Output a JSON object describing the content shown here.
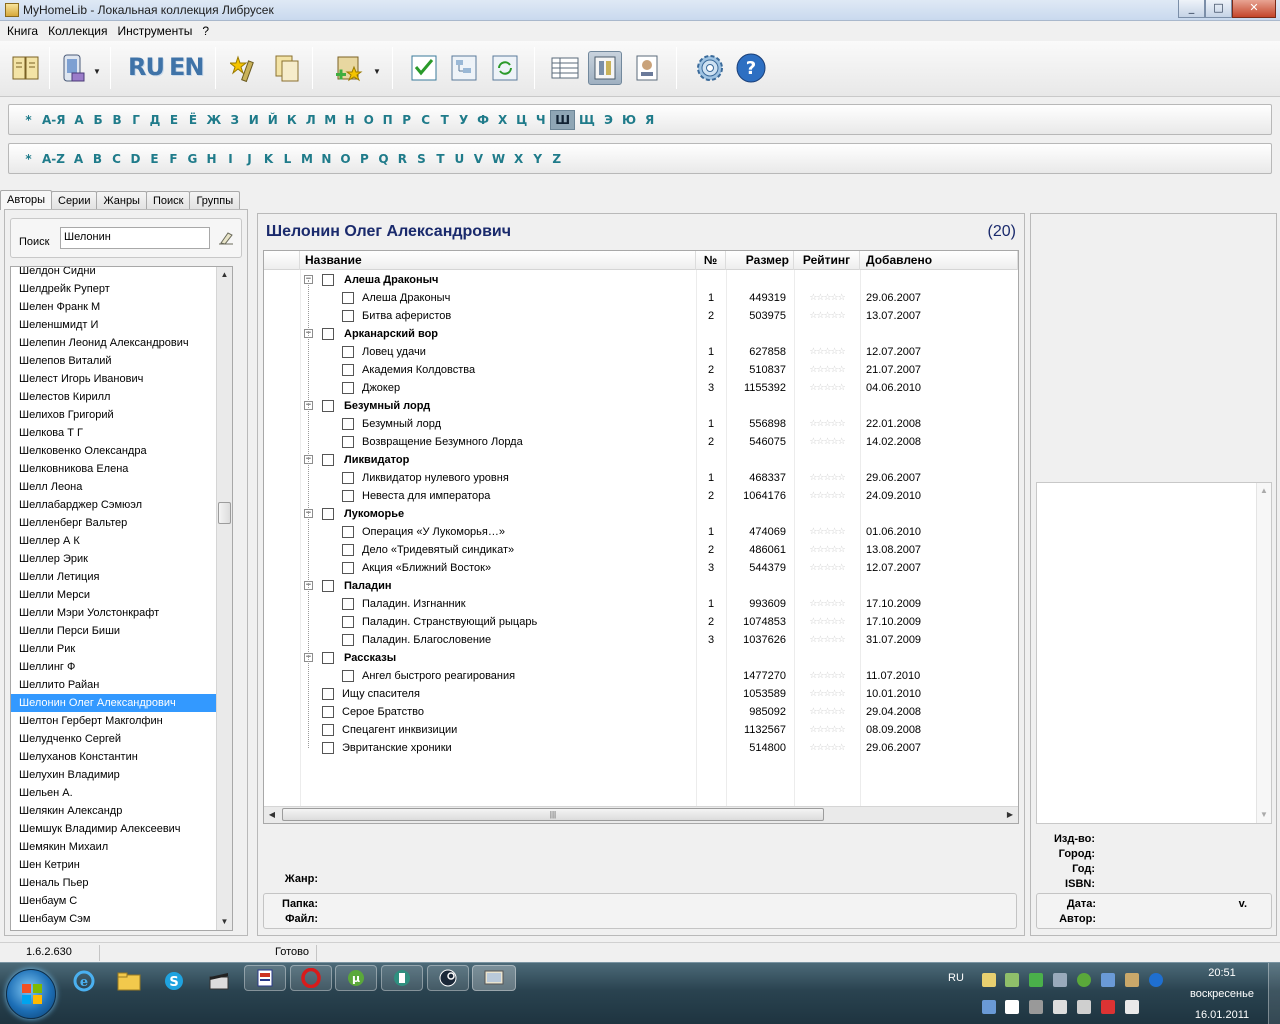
{
  "window": {
    "title": "MyHomeLib - Локальная коллекция Либрусек",
    "btn_min": "_",
    "btn_max": "□",
    "btn_close": "✕"
  },
  "menu": [
    "Книга",
    "Коллекция",
    "Инструменты",
    "?"
  ],
  "toolbar": {
    "lang_ru": "RU",
    "lang_en": "EN"
  },
  "alphabet_ru": [
    "*",
    "А-Я",
    "А",
    "Б",
    "В",
    "Г",
    "Д",
    "Е",
    "Ё",
    "Ж",
    "З",
    "И",
    "Й",
    "К",
    "Л",
    "М",
    "Н",
    "О",
    "П",
    "Р",
    "С",
    "Т",
    "У",
    "Ф",
    "Х",
    "Ц",
    "Ч",
    "Ш",
    "Щ",
    "Э",
    "Ю",
    "Я"
  ],
  "alphabet_ru_selected": "Ш",
  "alphabet_en": [
    "*",
    "A-Z",
    "A",
    "B",
    "C",
    "D",
    "E",
    "F",
    "G",
    "H",
    "I",
    "J",
    "K",
    "L",
    "M",
    "N",
    "O",
    "P",
    "Q",
    "R",
    "S",
    "T",
    "U",
    "V",
    "W",
    "X",
    "Y",
    "Z"
  ],
  "tabs": [
    "Авторы",
    "Серии",
    "Жанры",
    "Поиск",
    "Группы"
  ],
  "search": {
    "label": "Поиск",
    "value": "Шелонин"
  },
  "authors": [
    "Шелдон Сидни",
    "Шелдрейк Руперт",
    "Шелен Франк М",
    "Шеленшмидт И",
    "Шелепин Леонид Александрович",
    "Шелепов Виталий",
    "Шелест Игорь Иванович",
    "Шелестов Кирилл",
    "Шелихов Григорий",
    "Шелкова Т Г",
    "Шелковенко Олександра",
    "Шелковникова Елена",
    "Шелл Леона",
    "Шеллабарджер Сэмюэл",
    "Шелленберг Вальтер",
    "Шеллер А К",
    "Шеллер Эрик",
    "Шелли Летиция",
    "Шелли Мерси",
    "Шелли Мэри Уолстонкрафт",
    "Шелли Перси Биши",
    "Шелли Рик",
    "Шеллинг Ф",
    "Шеллито Райан",
    "Шелонин Олег Александрович",
    "Шелтон Герберт Макголфин",
    "Шелудченко Сергей",
    "Шелуханов Константин",
    "Шелухин Владимир",
    "Шельен А.",
    "Шелякин Александр",
    "Шемшук Владимир Алексеевич",
    "Шемякин Михаил",
    "Шен Кетрин",
    "Шеналь Пьер",
    "Шенбаум С",
    "Шенбаум Сэм"
  ],
  "authors_selected_index": 24,
  "center": {
    "author": "Шелонин Олег Александрович",
    "count": "(20)",
    "headers": {
      "title": "Название",
      "num": "№",
      "size": "Размер",
      "rating": "Рейтинг",
      "added": "Добавлено"
    },
    "rows": [
      {
        "type": "group",
        "title": "Алеша Драконыч"
      },
      {
        "type": "book",
        "title": "Алеша Драконыч",
        "num": "1",
        "size": "449319",
        "rating": "☆☆☆☆☆",
        "added": "29.06.2007"
      },
      {
        "type": "book",
        "title": "Битва аферистов",
        "num": "2",
        "size": "503975",
        "rating": "☆☆☆☆☆",
        "added": "13.07.2007"
      },
      {
        "type": "group",
        "title": "Арканарский вор"
      },
      {
        "type": "book",
        "title": "Ловец удачи",
        "num": "1",
        "size": "627858",
        "rating": "☆☆☆☆☆",
        "added": "12.07.2007"
      },
      {
        "type": "book",
        "title": "Академия Колдовства",
        "num": "2",
        "size": "510837",
        "rating": "☆☆☆☆☆",
        "added": "21.07.2007"
      },
      {
        "type": "book",
        "title": "Джокер",
        "num": "3",
        "size": "1155392",
        "rating": "☆☆☆☆☆",
        "added": "04.06.2010"
      },
      {
        "type": "group",
        "title": "Безумный лорд"
      },
      {
        "type": "book",
        "title": "Безумный лорд",
        "num": "1",
        "size": "556898",
        "rating": "☆☆☆☆☆",
        "added": "22.01.2008"
      },
      {
        "type": "book",
        "title": "Возвращение Безумного Лорда",
        "num": "2",
        "size": "546075",
        "rating": "☆☆☆☆☆",
        "added": "14.02.2008"
      },
      {
        "type": "group",
        "title": "Ликвидатор"
      },
      {
        "type": "book",
        "title": "Ликвидатор нулевого уровня",
        "num": "1",
        "size": "468337",
        "rating": "☆☆☆☆☆",
        "added": "29.06.2007"
      },
      {
        "type": "book",
        "title": "Невеста для императора",
        "num": "2",
        "size": "1064176",
        "rating": "☆☆☆☆☆",
        "added": "24.09.2010"
      },
      {
        "type": "group",
        "title": "Лукоморье"
      },
      {
        "type": "book",
        "title": "Операция «У Лукоморья…»",
        "num": "1",
        "size": "474069",
        "rating": "☆☆☆☆☆",
        "added": "01.06.2010"
      },
      {
        "type": "book",
        "title": "Дело «Тридевятый синдикат»",
        "num": "2",
        "size": "486061",
        "rating": "☆☆☆☆☆",
        "added": "13.08.2007"
      },
      {
        "type": "book",
        "title": "Акция «Ближний Восток»",
        "num": "3",
        "size": "544379",
        "rating": "☆☆☆☆☆",
        "added": "12.07.2007"
      },
      {
        "type": "group",
        "title": "Паладин"
      },
      {
        "type": "book",
        "title": "Паладин. Изгнанник",
        "num": "1",
        "size": "993609",
        "rating": "☆☆☆☆☆",
        "added": "17.10.2009"
      },
      {
        "type": "book",
        "title": "Паладин. Странствующий рыцарь",
        "num": "2",
        "size": "1074853",
        "rating": "☆☆☆☆☆",
        "added": "17.10.2009"
      },
      {
        "type": "book",
        "title": "Паладин. Благословение",
        "num": "3",
        "size": "1037626",
        "rating": "☆☆☆☆☆",
        "added": "31.07.2009"
      },
      {
        "type": "group",
        "title": "Рассказы"
      },
      {
        "type": "book",
        "title": "Ангел быстрого реагирования",
        "num": "",
        "size": "1477270",
        "rating": "☆☆☆☆☆",
        "added": "11.07.2010"
      },
      {
        "type": "single",
        "title": "Ищу спасителя",
        "num": "",
        "size": "1053589",
        "rating": "☆☆☆☆☆",
        "added": "10.01.2010"
      },
      {
        "type": "single",
        "title": "Серое Братство",
        "num": "",
        "size": "985092",
        "rating": "☆☆☆☆☆",
        "added": "29.04.2008"
      },
      {
        "type": "single",
        "title": "Спецагент инквизиции",
        "num": "",
        "size": "1132567",
        "rating": "☆☆☆☆☆",
        "added": "08.09.2008"
      },
      {
        "type": "single",
        "title": "Эвританские хроники",
        "num": "",
        "size": "514800",
        "rating": "☆☆☆☆☆",
        "added": "29.06.2007"
      }
    ],
    "genre_label": "Жанр:",
    "folder_label": "Папка:",
    "file_label": "Файл:"
  },
  "right": {
    "publisher_label": "Изд-во:",
    "city_label": "Город:",
    "year_label": "Год:",
    "isbn_label": "ISBN:",
    "date_label": "Дата:",
    "version_label": "v.",
    "author_label": "Автор:"
  },
  "status": {
    "version": "1.6.2.630",
    "state": "Готово"
  },
  "taskbar": {
    "lang": "RU",
    "time": "20:51",
    "day": "воскресенье",
    "date": "16.01.2011"
  }
}
